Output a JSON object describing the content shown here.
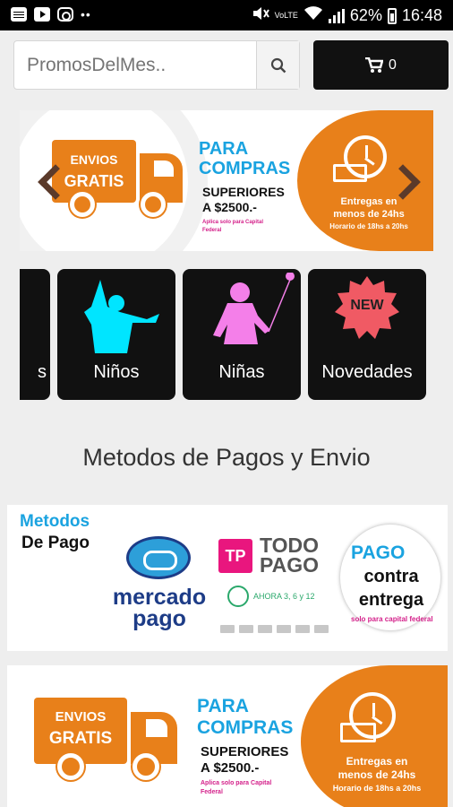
{
  "status_bar": {
    "battery": "62%",
    "time": "16:48",
    "network_label": "VoLTE"
  },
  "search": {
    "placeholder": "PromosDelMes.."
  },
  "cart": {
    "count": "0"
  },
  "promo_banner": {
    "truck_line1": "ENVIOS",
    "truck_line2": "GRATIS",
    "para": "PARA",
    "compras": "COMPRAS",
    "superiores": "SUPERIORES",
    "amount": "A $2500.-",
    "note_line1": "Aplica solo para Capital",
    "note_line2": "Federal",
    "delivery_line1": "Entregas en",
    "delivery_line2": "menos de 24hs",
    "hours": "Horario de 18hs a 20hs"
  },
  "categories": [
    {
      "label": "s"
    },
    {
      "label": "Niños"
    },
    {
      "label": "Niñas"
    },
    {
      "label": "Novedades",
      "badge": "NEW"
    }
  ],
  "section_title": "Metodos de Pagos y Envio",
  "payment_card": {
    "title_line1": "Metodos",
    "title_line2": "De Pago",
    "mercadopago_line1": "mercado",
    "mercadopago_line2": "pago",
    "todopago_mark": "TP",
    "todopago_line1": "TODO",
    "todopago_line2": "PAGO",
    "ahora_label": "AHORA 3, 6 y 12",
    "cash_line1": "PAGO",
    "cash_line2": "contra",
    "cash_line3": "entrega",
    "cash_note": "solo para capital federal"
  },
  "colors": {
    "orange": "#e8801a",
    "blue": "#1aa3e0",
    "pink": "#d4208a",
    "cyan": "#00e5ff",
    "magenta_silhouette": "#f47fe9",
    "new_badge": "#f05a64"
  }
}
